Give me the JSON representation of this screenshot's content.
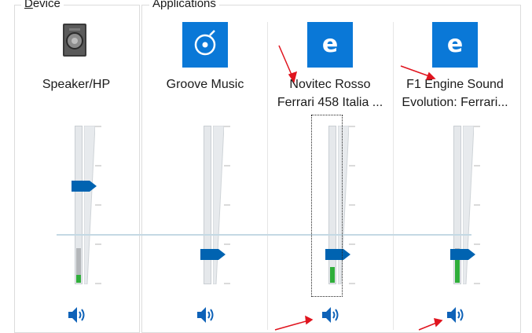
{
  "device_group": {
    "label_mnemonic": "D",
    "label_rest": "evice"
  },
  "applications_group": {
    "label": "Applications"
  },
  "channels": [
    {
      "name_lines": [
        "Speaker/HP"
      ],
      "icon": "speaker-device-icon",
      "volume_percent": 62,
      "peak_percent": 22,
      "active_percent": 5
    },
    {
      "name_lines": [
        "Groove Music"
      ],
      "icon": "groove-music-icon",
      "volume_percent": 19,
      "peak_percent": 0,
      "active_percent": 0
    },
    {
      "name_lines": [
        "Novitec Rosso",
        "Ferrari 458 Italia ..."
      ],
      "icon": "edge-browser-icon",
      "volume_percent": 19,
      "peak_percent": 10,
      "active_percent": 10
    },
    {
      "name_lines": [
        "F1 Engine Sound",
        "Evolution: Ferrari..."
      ],
      "icon": "edge-browser-icon",
      "volume_percent": 19,
      "peak_percent": 22,
      "active_percent": 15
    }
  ],
  "colors": {
    "tile_blue": "#0a78d7",
    "slider_blue": "#0063b1",
    "peak_green": "#2fae3a",
    "annotation_red": "#e0141e"
  }
}
